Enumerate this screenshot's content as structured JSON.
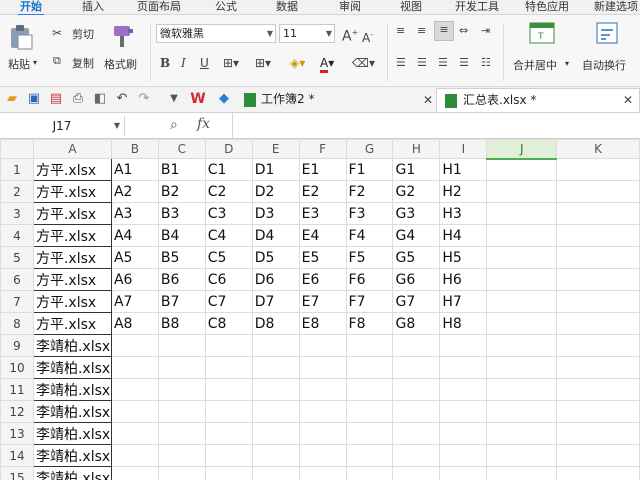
{
  "menu_tabs": [
    {
      "label": "开始",
      "active": true
    },
    {
      "label": "插入",
      "active": false
    },
    {
      "label": "页面布局",
      "active": false
    },
    {
      "label": "公式",
      "active": false
    },
    {
      "label": "数据",
      "active": false
    },
    {
      "label": "审阅",
      "active": false
    },
    {
      "label": "视图",
      "active": false
    },
    {
      "label": "开发工具",
      "active": false
    },
    {
      "label": "特色应用",
      "active": false
    },
    {
      "label": "新建选项",
      "active": false
    }
  ],
  "ribbon": {
    "paste_label": "粘贴",
    "cut_label": "剪切",
    "copy_label": "复制",
    "format_painter_label": "格式刷",
    "font_name": "微软雅黑",
    "font_size": "11",
    "merge_center_label": "合并居中",
    "wrap_text_label": "自动换行"
  },
  "doc_tabs": [
    {
      "label": "工作簿2 *",
      "active": false
    },
    {
      "label": "汇总表.xlsx *",
      "active": true
    }
  ],
  "formula_bar": {
    "cell_ref": "J17",
    "fx_label": "fx",
    "value": ""
  },
  "sheet": {
    "selected_column": "J",
    "columns": [
      "A",
      "B",
      "C",
      "D",
      "E",
      "F",
      "G",
      "H",
      "I",
      "J",
      "K"
    ],
    "rows": [
      {
        "num": "1",
        "cells": [
          "方平.xlsx",
          "A1",
          "B1",
          "C1",
          "D1",
          "E1",
          "F1",
          "G1",
          "H1"
        ]
      },
      {
        "num": "2",
        "cells": [
          "方平.xlsx",
          "A2",
          "B2",
          "C2",
          "D2",
          "E2",
          "F2",
          "G2",
          "H2"
        ]
      },
      {
        "num": "3",
        "cells": [
          "方平.xlsx",
          "A3",
          "B3",
          "C3",
          "D3",
          "E3",
          "F3",
          "G3",
          "H3"
        ]
      },
      {
        "num": "4",
        "cells": [
          "方平.xlsx",
          "A4",
          "B4",
          "C4",
          "D4",
          "E4",
          "F4",
          "G4",
          "H4"
        ]
      },
      {
        "num": "5",
        "cells": [
          "方平.xlsx",
          "A5",
          "B5",
          "C5",
          "D5",
          "E5",
          "F5",
          "G5",
          "H5"
        ]
      },
      {
        "num": "6",
        "cells": [
          "方平.xlsx",
          "A6",
          "B6",
          "C6",
          "D6",
          "E6",
          "F6",
          "G6",
          "H6"
        ]
      },
      {
        "num": "7",
        "cells": [
          "方平.xlsx",
          "A7",
          "B7",
          "C7",
          "D7",
          "E7",
          "F7",
          "G7",
          "H7"
        ]
      },
      {
        "num": "8",
        "cells": [
          "方平.xlsx",
          "A8",
          "B8",
          "C8",
          "D8",
          "E8",
          "F8",
          "G8",
          "H8"
        ]
      },
      {
        "num": "9",
        "cells": [
          "李靖柏.xlsx"
        ]
      },
      {
        "num": "10",
        "cells": [
          "李靖柏.xlsx"
        ]
      },
      {
        "num": "11",
        "cells": [
          "李靖柏.xlsx"
        ]
      },
      {
        "num": "12",
        "cells": [
          "李靖柏.xlsx"
        ]
      },
      {
        "num": "13",
        "cells": [
          "李靖柏.xlsx"
        ]
      },
      {
        "num": "14",
        "cells": [
          "李靖柏.xlsx"
        ]
      },
      {
        "num": "15",
        "cells": [
          "李靖柏.xlsx"
        ]
      }
    ]
  },
  "colors": {
    "accent": "#2a7de1",
    "selected_header": "#e2efd8"
  }
}
